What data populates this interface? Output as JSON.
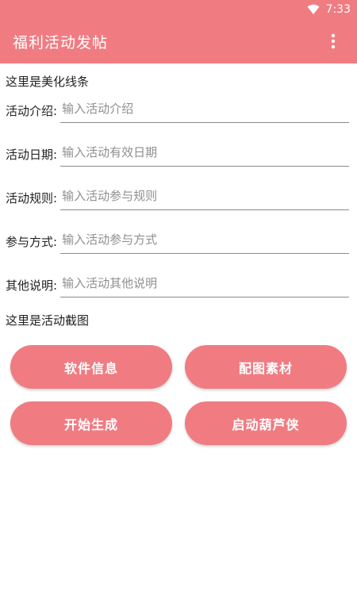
{
  "status_bar": {
    "time": "7:33",
    "wifi_icon": "wifi-icon"
  },
  "app_bar": {
    "title": "福利活动发帖",
    "menu_icon": "more-vert-icon"
  },
  "labels": {
    "decoration_line": "这里是美化线条",
    "screenshot": "这里是活动截图"
  },
  "fields": [
    {
      "label": "活动介绍:",
      "placeholder": "输入活动介绍",
      "value": ""
    },
    {
      "label": "活动日期:",
      "placeholder": "输入活动有效日期",
      "value": ""
    },
    {
      "label": "活动规则:",
      "placeholder": "输入活动参与规则",
      "value": ""
    },
    {
      "label": "参与方式:",
      "placeholder": "输入活动参与方式",
      "value": ""
    },
    {
      "label": "其他说明:",
      "placeholder": "输入活动其他说明",
      "value": ""
    }
  ],
  "buttons": {
    "software_info": "软件信息",
    "image_material": "配图素材",
    "start_generate": "开始生成",
    "launch_huluxia": "启动葫芦侠"
  },
  "colors": {
    "accent": "#f07c82",
    "underline": "#8a8a8a"
  }
}
